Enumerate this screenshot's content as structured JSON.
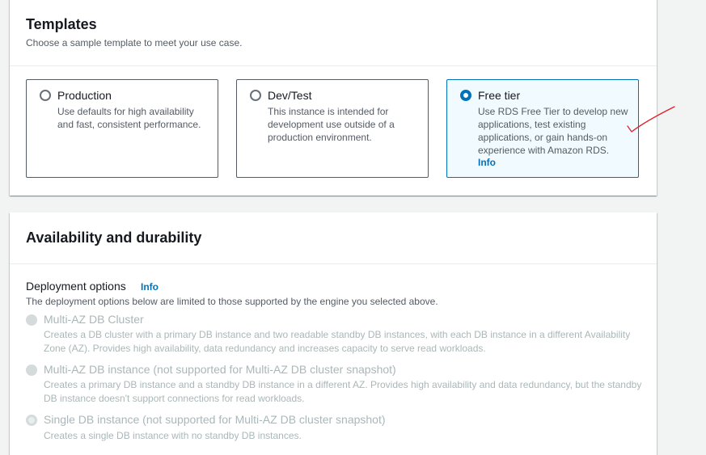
{
  "templates": {
    "title": "Templates",
    "description": "Choose a sample template to meet your use case.",
    "options": [
      {
        "label": "Production",
        "description": "Use defaults for high availability and fast, consistent performance.",
        "selected": false
      },
      {
        "label": "Dev/Test",
        "description": "This instance is intended for development use outside of a production environment.",
        "selected": false
      },
      {
        "label": "Free tier",
        "description": "Use RDS Free Tier to develop new applications, test existing applications, or gain hands-on experience with Amazon RDS.",
        "info": "Info",
        "selected": true
      }
    ]
  },
  "availability": {
    "title": "Availability and durability",
    "deployment_label": "Deployment options",
    "deployment_info": "Info",
    "deployment_description": "The deployment options below are limited to those supported by the engine you selected above.",
    "options": [
      {
        "label": "Multi-AZ DB Cluster",
        "description": "Creates a DB cluster with a primary DB instance and two readable standby DB instances, with each DB instance in a different Availability Zone (AZ). Provides high availability, data redundancy and increases capacity to serve read workloads.",
        "disabled": true
      },
      {
        "label": "Multi-AZ DB instance (not supported for Multi-AZ DB cluster snapshot)",
        "description": "Creates a primary DB instance and a standby DB instance in a different AZ. Provides high availability and data redundancy, but the standby DB instance doesn't support connections for read workloads.",
        "disabled": true
      },
      {
        "label": "Single DB instance (not supported for Multi-AZ DB cluster snapshot)",
        "description": "Creates a single DB instance with no standby DB instances.",
        "disabled": true,
        "selected": true
      }
    ]
  },
  "annotation": {
    "icon": "checkmark-annotation-icon",
    "color": "#e0202a"
  },
  "colors": {
    "accent": "#0073bb",
    "selected_bg": "#f1faff",
    "disabled": "#aab7b8"
  }
}
